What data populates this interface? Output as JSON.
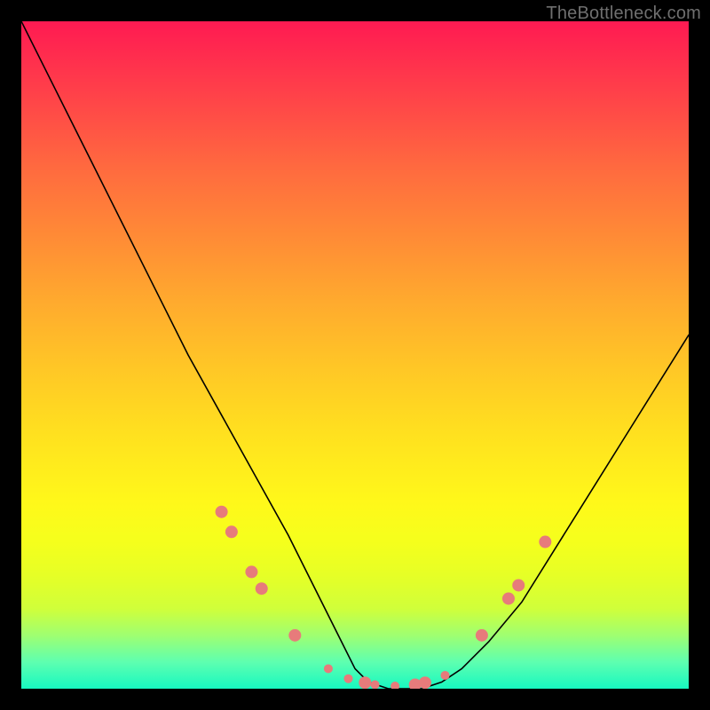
{
  "watermark": "TheBottleneck.com",
  "chart_data": {
    "type": "line",
    "title": "",
    "xlabel": "",
    "ylabel": "",
    "xlim": [
      0,
      100
    ],
    "ylim": [
      0,
      100
    ],
    "grid": false,
    "legend": false,
    "series": [
      {
        "name": "curve",
        "x": [
          0,
          5,
          10,
          15,
          20,
          25,
          30,
          35,
          40,
          45,
          48,
          50,
          52,
          55,
          58,
          60,
          63,
          66,
          70,
          75,
          80,
          85,
          90,
          95,
          100
        ],
        "y": [
          100,
          90,
          80,
          70,
          60,
          50,
          41,
          32,
          23,
          13,
          7,
          3,
          1,
          0,
          0,
          0,
          1,
          3,
          7,
          13,
          21,
          29,
          37,
          45,
          53
        ],
        "color": "#000000",
        "linewidth": 1.6
      }
    ],
    "markers": {
      "name": "dots",
      "color": "#e77b7b",
      "radius_major": 7,
      "radius_minor": 5,
      "points": [
        {
          "x": 30.0,
          "y": 26.5,
          "r": "major"
        },
        {
          "x": 31.5,
          "y": 23.5,
          "r": "major"
        },
        {
          "x": 34.5,
          "y": 17.5,
          "r": "major"
        },
        {
          "x": 36.0,
          "y": 15.0,
          "r": "major"
        },
        {
          "x": 41.0,
          "y": 8.0,
          "r": "major"
        },
        {
          "x": 46.0,
          "y": 3.0,
          "r": "minor"
        },
        {
          "x": 49.0,
          "y": 1.5,
          "r": "minor"
        },
        {
          "x": 51.5,
          "y": 0.9,
          "r": "major"
        },
        {
          "x": 53.0,
          "y": 0.6,
          "r": "minor"
        },
        {
          "x": 56.0,
          "y": 0.4,
          "r": "minor"
        },
        {
          "x": 59.0,
          "y": 0.6,
          "r": "major"
        },
        {
          "x": 60.5,
          "y": 0.9,
          "r": "major"
        },
        {
          "x": 63.5,
          "y": 2.0,
          "r": "minor"
        },
        {
          "x": 69.0,
          "y": 8.0,
          "r": "major"
        },
        {
          "x": 73.0,
          "y": 13.5,
          "r": "major"
        },
        {
          "x": 74.5,
          "y": 15.5,
          "r": "major"
        },
        {
          "x": 78.5,
          "y": 22.0,
          "r": "major"
        }
      ]
    }
  }
}
